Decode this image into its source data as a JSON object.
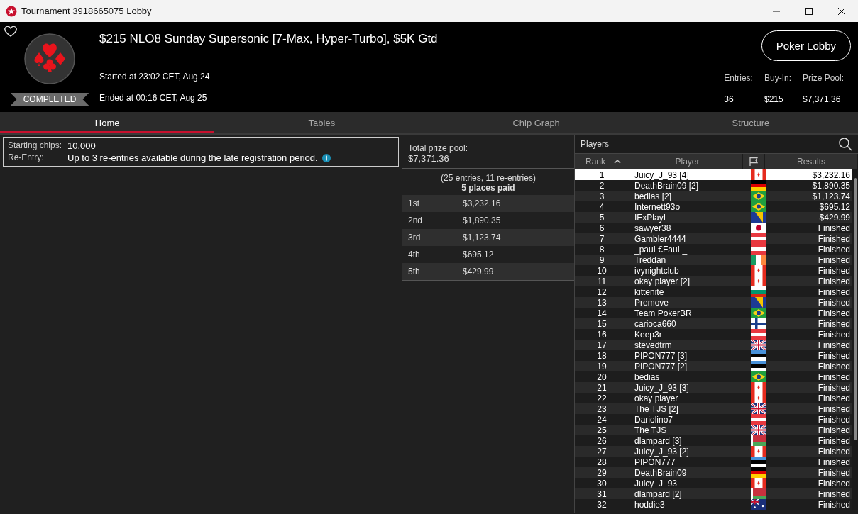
{
  "window": {
    "title": "Tournament 3918665075 Lobby"
  },
  "header": {
    "title": "$215 NLO8 Sunday Supersonic [7-Max, Hyper-Turbo], $5K Gtd",
    "status": "COMPLETED",
    "started": "Started at 23:02 CET, Aug 24",
    "ended": "Ended at 00:16 CET, Aug 25",
    "lobby_button": "Poker Lobby",
    "stats": [
      {
        "label": "Entries:",
        "value": "36"
      },
      {
        "label": "Buy-In:",
        "value": "$215"
      },
      {
        "label": "Prize Pool:",
        "value": "$7,371.36"
      }
    ]
  },
  "tabs": [
    {
      "label": "Home",
      "selected": true
    },
    {
      "label": "Tables",
      "selected": false
    },
    {
      "label": "Chip Graph",
      "selected": false
    },
    {
      "label": "Structure",
      "selected": false
    }
  ],
  "info": [
    {
      "label": "Starting chips:",
      "value": "10,000",
      "info": false
    },
    {
      "label": "Re-Entry:",
      "value": "Up to 3 re-entries available during the late registration period.",
      "info": true
    }
  ],
  "prizes": {
    "label": "Total prize pool:",
    "total": "$7,371.36",
    "entries": "(25 entries, 11 re-entries)",
    "paid": "5 places paid",
    "places": [
      {
        "place": "1st",
        "amount": "$3,232.16"
      },
      {
        "place": "2nd",
        "amount": "$1,890.35"
      },
      {
        "place": "3rd",
        "amount": "$1,123.74"
      },
      {
        "place": "4th",
        "amount": "$695.12"
      },
      {
        "place": "5th",
        "amount": "$429.99"
      }
    ]
  },
  "players": {
    "title": "Players",
    "columns": [
      {
        "label": "Rank",
        "sorted": true
      },
      {
        "label": "Player",
        "sorted": false
      },
      {
        "label": "Results",
        "sorted": false
      }
    ],
    "rows": [
      {
        "rank": "1",
        "player": "Juicy_J_93 [4]",
        "kind": "ca",
        "result": "$3,232.16",
        "selected": true
      },
      {
        "rank": "2",
        "player": "DeathBrain09 [2]",
        "kind": "de",
        "result": "$1,890.35",
        "selected": false
      },
      {
        "rank": "3",
        "player": "bedias [2]",
        "kind": "br",
        "result": "$1,123.74",
        "selected": false
      },
      {
        "rank": "4",
        "player": "Internett93o",
        "kind": "br",
        "result": "$695.12",
        "selected": false
      },
      {
        "rank": "5",
        "player": "IExPlayI",
        "kind": "ba",
        "result": "$429.99",
        "selected": false
      },
      {
        "rank": "6",
        "player": "sawyer38",
        "kind": "jp",
        "result": "Finished",
        "selected": false
      },
      {
        "rank": "7",
        "player": "Gambler4444",
        "kind": "at",
        "result": "Finished",
        "selected": false
      },
      {
        "rank": "8",
        "player": "_pauL€FauL_",
        "kind": "at",
        "result": "Finished",
        "selected": false
      },
      {
        "rank": "9",
        "player": "Treddan",
        "kind": "ie",
        "result": "Finished",
        "selected": false
      },
      {
        "rank": "10",
        "player": "ivynightclub",
        "kind": "ca",
        "result": "Finished",
        "selected": false
      },
      {
        "rank": "11",
        "player": "okay player [2]",
        "kind": "ca",
        "result": "Finished",
        "selected": false
      },
      {
        "rank": "12",
        "player": "kittenite",
        "kind": "bg",
        "result": "Finished",
        "selected": false
      },
      {
        "rank": "13",
        "player": "Premove",
        "kind": "ba",
        "result": "Finished",
        "selected": false
      },
      {
        "rank": "14",
        "player": "Team PokerBR",
        "kind": "br",
        "result": "Finished",
        "selected": false
      },
      {
        "rank": "15",
        "player": "carioca660",
        "kind": "fi",
        "result": "Finished",
        "selected": false
      },
      {
        "rank": "16",
        "player": "Keep3r",
        "kind": "at",
        "result": "Finished",
        "selected": false
      },
      {
        "rank": "17",
        "player": "stevedtrm",
        "kind": "gb",
        "result": "Finished",
        "selected": false
      },
      {
        "rank": "18",
        "player": "PIPON777 [3]",
        "kind": "ee",
        "result": "Finished",
        "selected": false
      },
      {
        "rank": "19",
        "player": "PIPON777 [2]",
        "kind": "ee",
        "result": "Finished",
        "selected": false
      },
      {
        "rank": "20",
        "player": "bedias",
        "kind": "br",
        "result": "Finished",
        "selected": false
      },
      {
        "rank": "21",
        "player": "Juicy_J_93 [3]",
        "kind": "ca",
        "result": "Finished",
        "selected": false
      },
      {
        "rank": "22",
        "player": "okay player",
        "kind": "ca",
        "result": "Finished",
        "selected": false
      },
      {
        "rank": "23",
        "player": "The TJS [2]",
        "kind": "gb",
        "result": "Finished",
        "selected": false
      },
      {
        "rank": "24",
        "player": "Dariolino7",
        "kind": "at",
        "result": "Finished",
        "selected": false
      },
      {
        "rank": "25",
        "player": "The TJS",
        "kind": "gb",
        "result": "Finished",
        "selected": false
      },
      {
        "rank": "26",
        "player": "dlampard [3]",
        "kind": "by",
        "result": "Finished",
        "selected": false
      },
      {
        "rank": "27",
        "player": "Juicy_J_93 [2]",
        "kind": "ca",
        "result": "Finished",
        "selected": false
      },
      {
        "rank": "28",
        "player": "PIPON777",
        "kind": "ee",
        "result": "Finished",
        "selected": false
      },
      {
        "rank": "29",
        "player": "DeathBrain09",
        "kind": "de",
        "result": "Finished",
        "selected": false
      },
      {
        "rank": "30",
        "player": "Juicy_J_93",
        "kind": "ca",
        "result": "Finished",
        "selected": false
      },
      {
        "rank": "31",
        "player": "dlampard [2]",
        "kind": "by",
        "result": "Finished",
        "selected": false
      },
      {
        "rank": "32",
        "player": "hoddie3",
        "kind": "au",
        "result": "Finished",
        "selected": false
      }
    ]
  }
}
